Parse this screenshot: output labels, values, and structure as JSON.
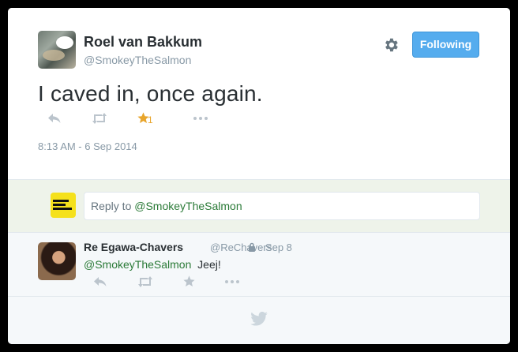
{
  "tweet": {
    "author_name": "Roel van Bakkum",
    "author_handle": "@SmokeyTheSalmon",
    "text": "I caved in, once again.",
    "favorite_count": "1",
    "timestamp": "8:13 AM - 6 Sep 2014",
    "follow_label": "Following"
  },
  "reply_box": {
    "prefix": "Reply to ",
    "mention": "@SmokeyTheSalmon"
  },
  "reply_tweet": {
    "author_name": "Re Egawa-Chavers",
    "author_handle": "@ReChavers",
    "date": "· Sep 8",
    "mention": "@SmokeyTheSalmon",
    "text": "Jeej!"
  },
  "colors": {
    "follow_button": "#55acee",
    "favorite": "#e8a52c",
    "mention": "#2a7a37",
    "muted": "#8899a6"
  },
  "icons": [
    "reply-icon",
    "retweet-icon",
    "favorite-icon",
    "more-icon",
    "gear-icon",
    "lock-icon",
    "twitter-bird-icon"
  ]
}
